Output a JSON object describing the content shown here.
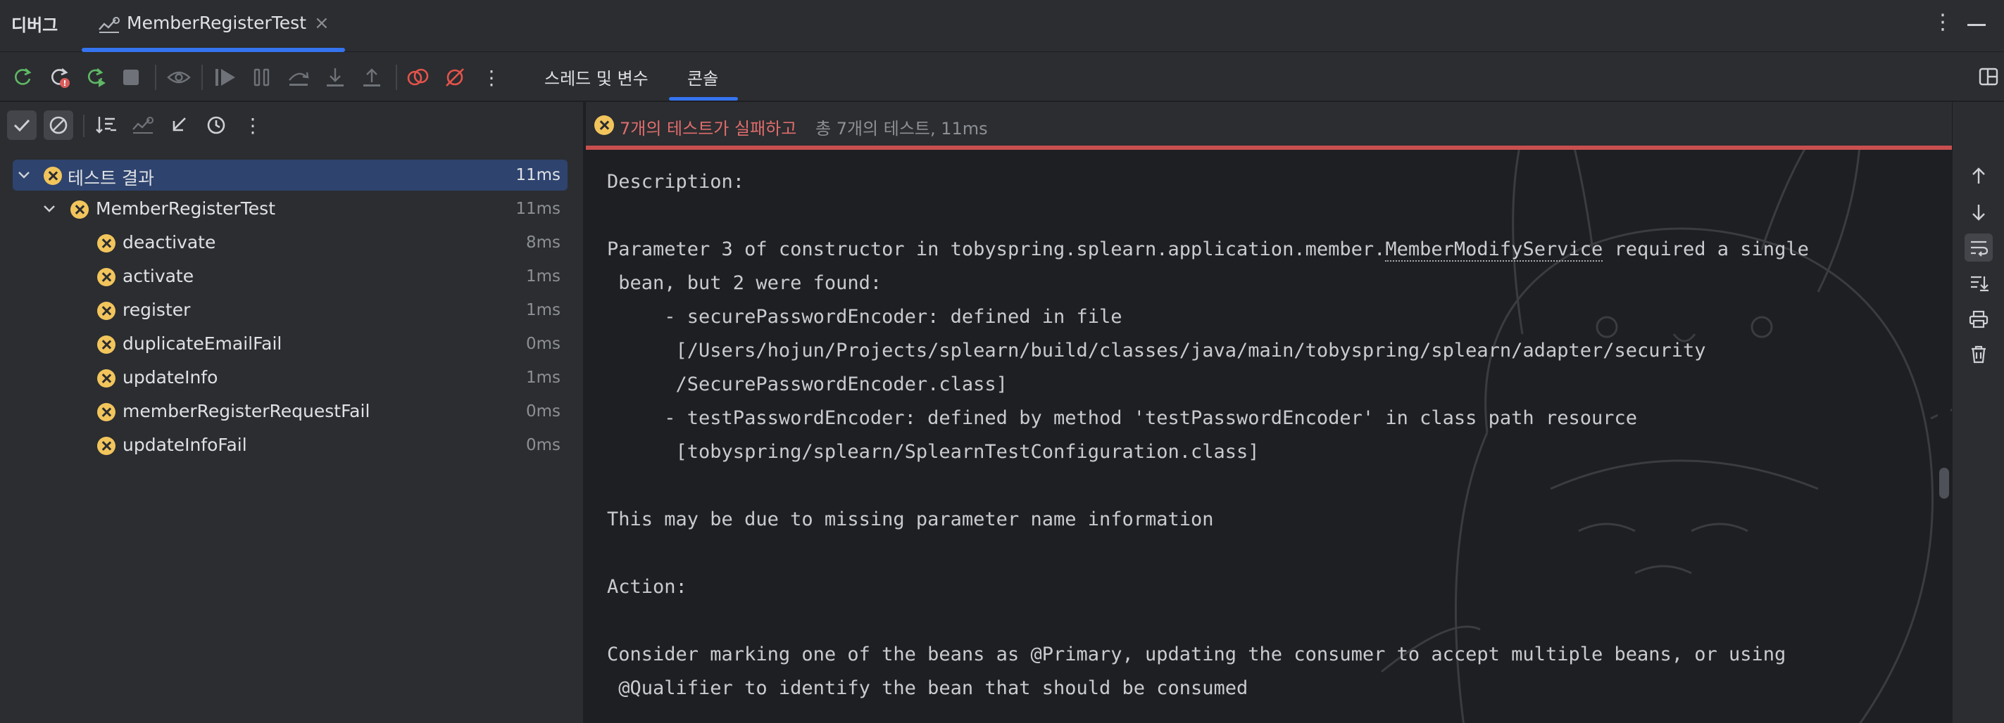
{
  "header": {
    "panel_title": "디버그",
    "tab_label": "MemberRegisterTest",
    "tab_close": "×",
    "more": "⋮"
  },
  "toolbar": {
    "tabs": [
      {
        "label": "스레드 및 변수"
      },
      {
        "label": "콘솔",
        "active": true
      }
    ],
    "icons": [
      "rerun-icon",
      "rerun-failed-icon",
      "rerun-automatically-icon",
      "stop-icon",
      "view-breakpoints-icon",
      "resume-icon",
      "pause-icon",
      "step-over-icon",
      "step-into-icon",
      "step-out-icon",
      "view-breakpoints-red-icon",
      "mute-breakpoints-icon",
      "more-icon"
    ]
  },
  "test_tree": {
    "toolbar_icons": [
      "show-passed-icon",
      "show-ignored-icon",
      "sort-icon",
      "import-tests-icon",
      "collapse-icon",
      "history-icon",
      "more-icon"
    ],
    "root": {
      "label": "테스트 결과",
      "time": "11ms",
      "status": "failed"
    },
    "class": {
      "label": "MemberRegisterTest",
      "time": "11ms",
      "status": "failed"
    },
    "tests": [
      {
        "label": "deactivate",
        "time": "8ms",
        "status": "failed"
      },
      {
        "label": "activate",
        "time": "1ms",
        "status": "failed"
      },
      {
        "label": "register",
        "time": "1ms",
        "status": "failed"
      },
      {
        "label": "duplicateEmailFail",
        "time": "0ms",
        "status": "failed"
      },
      {
        "label": "updateInfo",
        "time": "1ms",
        "status": "failed"
      },
      {
        "label": "memberRegisterRequestFail",
        "time": "0ms",
        "status": "failed"
      },
      {
        "label": "updateInfoFail",
        "time": "0ms",
        "status": "failed"
      }
    ]
  },
  "console": {
    "status_failed": "7개의 테스트가 실패하고",
    "status_summary": "총 7개의 테스트, 11ms",
    "lines": {
      "l1": "Description:",
      "l2": "",
      "l3a": "Parameter 3 of constructor in tobyspring.splearn.application.member.",
      "l3b": "MemberModifyService",
      "l3c": " required a single",
      "l4": " bean, but 2 were found:",
      "l5": "     - securePasswordEncoder: defined in file",
      "l6": "      [/Users/hojun/Projects/splearn/build/classes/java/main/tobyspring/splearn/adapter/security",
      "l7": "      /SecurePasswordEncoder.class]",
      "l8": "     - testPasswordEncoder: defined by method 'testPasswordEncoder' in class path resource",
      "l9": "      [tobyspring/splearn/SplearnTestConfiguration.class]",
      "l10": "",
      "l11": "This may be due to missing parameter name information",
      "l12": "",
      "l13": "Action:",
      "l14": "",
      "l15": "Consider marking one of the beans as @Primary, updating the consumer to accept multiple beans, or using",
      "l16": " @Qualifier to identify the bean that should be consumed"
    }
  },
  "right_strip_icons": [
    "scroll-up-icon",
    "scroll-down-icon",
    "soft-wrap-icon",
    "scroll-to-end-icon",
    "print-icon",
    "clear-all-icon"
  ],
  "colors": {
    "accent": "#3574f0",
    "failed": "#f2c55c",
    "error_text": "#e06c6c",
    "selection": "#2e436e",
    "panel_bg": "#2b2d30",
    "console_bg": "#1e1f22"
  }
}
